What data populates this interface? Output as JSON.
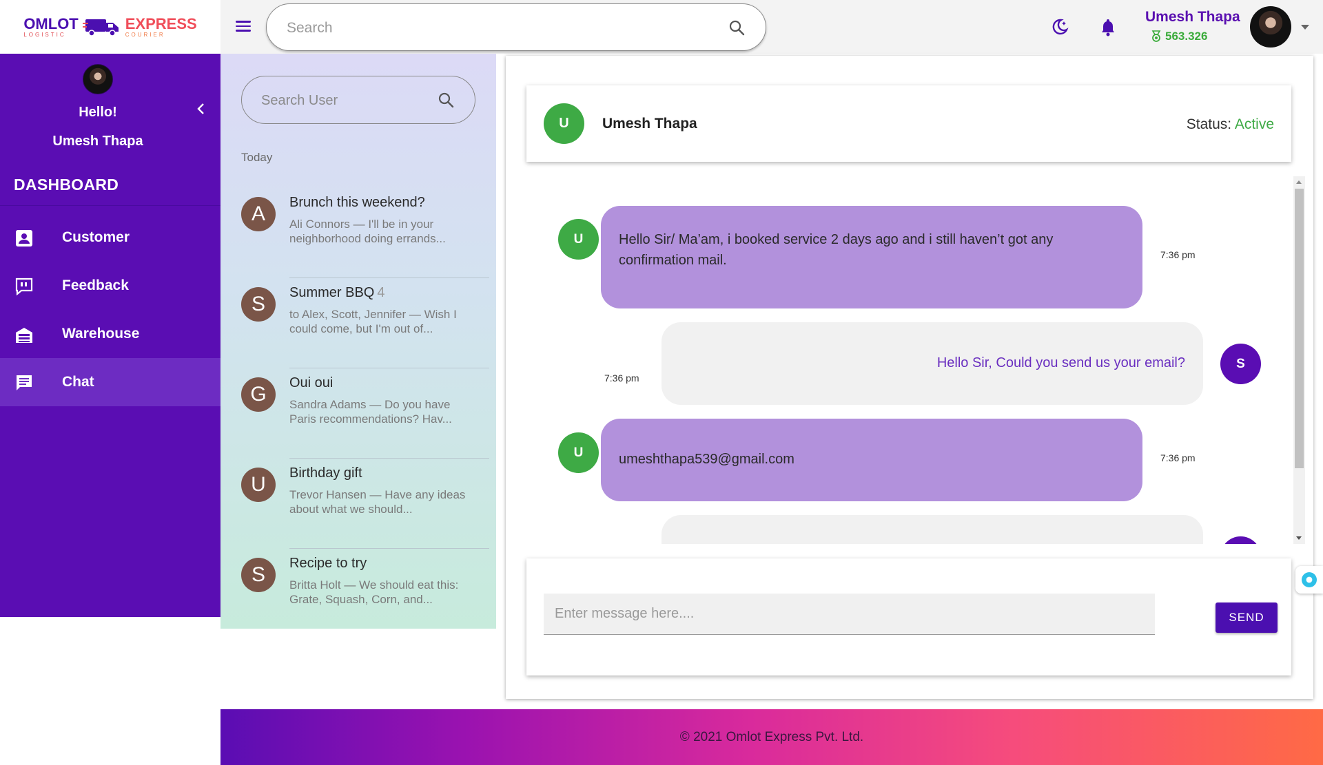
{
  "logo": {
    "word1": "OMLOT",
    "word2": "EXPRESS",
    "sub1": "LOGISTIC",
    "sub2": "COURIER"
  },
  "topbar": {
    "search_placeholder": "Search",
    "user_name": "Umesh Thapa",
    "points": "563.326"
  },
  "sidebar": {
    "greeting": "Hello!",
    "user_name": "Umesh Thapa",
    "section": "DASHBOARD",
    "items": [
      {
        "label": "Customer",
        "icon": "contact-card-icon"
      },
      {
        "label": "Feedback",
        "icon": "feedback-icon"
      },
      {
        "label": "Warehouse",
        "icon": "warehouse-icon"
      },
      {
        "label": "Chat",
        "icon": "chat-icon",
        "active": true
      }
    ]
  },
  "conversations": {
    "search_placeholder": "Search User",
    "group_label": "Today",
    "items": [
      {
        "initial": "A",
        "title": "Brunch this weekend?",
        "count": "",
        "preview": "Ali Connors — I'll be in your neighborhood doing errands..."
      },
      {
        "initial": "S",
        "title": "Summer BBQ",
        "count": "4",
        "preview": "to Alex, Scott, Jennifer — Wish I could come, but I'm out of..."
      },
      {
        "initial": "G",
        "title": "Oui oui",
        "count": "",
        "preview": "Sandra Adams — Do you have Paris recommendations? Hav..."
      },
      {
        "initial": "U",
        "title": "Birthday gift",
        "count": "",
        "preview": "Trevor Hansen — Have any ideas about what we should..."
      },
      {
        "initial": "S",
        "title": "Recipe to try",
        "count": "",
        "preview": "Britta Holt — We should eat this: Grate, Squash, Corn, and..."
      }
    ]
  },
  "chat": {
    "contact_initial": "U",
    "contact_name": "Umesh Thapa",
    "status_label": "Status:",
    "status_value": "Active",
    "messages": [
      {
        "from": "U",
        "text": "Hello Sir/ Ma’am, i booked service 2 days ago and i still haven’t got any confirmation mail.",
        "time": "7:36 pm"
      },
      {
        "from": "S",
        "text": "Hello Sir, Could you send us your email?",
        "time": "7:36 pm"
      },
      {
        "from": "U",
        "text": "umeshthapa539@gmail.com",
        "time": "7:36 pm"
      }
    ],
    "input_placeholder": "Enter message here....",
    "send_label": "SEND"
  },
  "footer": {
    "copyright": "© 2021 Omlot Express Pvt. Ltd."
  },
  "colors": {
    "primary": "#5a0db3",
    "accent_green": "#3eaa45",
    "bubble_in": "#b291dc",
    "bubble_out": "#f1f1f1"
  }
}
